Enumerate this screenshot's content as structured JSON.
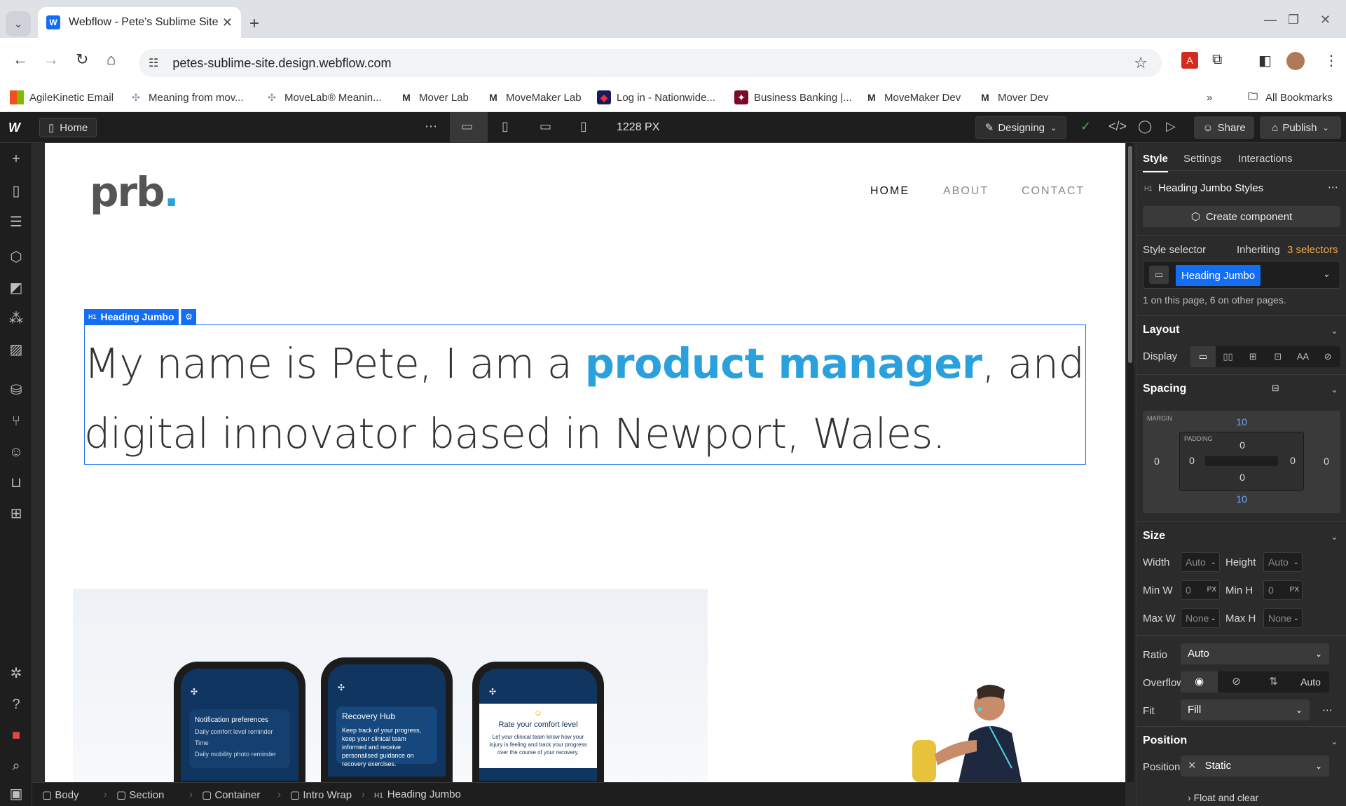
{
  "browser": {
    "tab_title": "Webflow - Pete's Sublime Site",
    "tab_favicon": "W",
    "url": "petes-sublime-site.design.webflow.com",
    "bookmarks": [
      {
        "label": "AgileKinetic Email",
        "icon": "microsoft-icon"
      },
      {
        "label": "Meaning from mov...",
        "icon": "movelab-icon"
      },
      {
        "label": "MoveLab® Meanin...",
        "icon": "movelab-icon"
      },
      {
        "label": "Mover Lab",
        "icon": "M"
      },
      {
        "label": "MoveMaker Lab",
        "icon": "M"
      },
      {
        "label": "Log in - Nationwide...",
        "icon": "nationwide-icon"
      },
      {
        "label": "Business Banking |...",
        "icon": "bank-icon"
      },
      {
        "label": "MoveMaker Dev",
        "icon": "M"
      },
      {
        "label": "Mover Dev",
        "icon": "M"
      }
    ],
    "all_bookmarks_label": "All Bookmarks"
  },
  "designer": {
    "page_label": "Home",
    "width_label": "1228 PX",
    "mode_label": "Designing",
    "share_label": "Share",
    "publish_label": "Publish"
  },
  "site": {
    "logo_text": "prb",
    "logo_dot": ".",
    "nav": [
      "HOME",
      "ABOUT",
      "CONTACT"
    ],
    "heading_before": "My name is Pete, I am a ",
    "heading_highlight": "product manager",
    "heading_after": ", and digital innovator based in Newport, Wales.",
    "highlight_color": "#2aa1dd",
    "phones": [
      {
        "title": "Notification preferences",
        "line1": "Daily comfort level reminder",
        "line2": "Time",
        "line3": "Daily mobility photo reminder"
      },
      {
        "title": "Recovery Hub",
        "text": "Keep track of your progress, keep your clinical team informed and receive personalised guidance on recovery exercises."
      },
      {
        "title": "Rate your comfort level",
        "text": "Let your clinical team know how your injury is feeling and track your progress over the course of your recovery."
      }
    ]
  },
  "selection": {
    "tag": "H1",
    "label": "Heading Jumbo",
    "accent": "#146ef5"
  },
  "breadcrumbs": [
    "Body",
    "Section",
    "Container",
    "Intro Wrap",
    "Heading Jumbo"
  ],
  "breadcrumb_heading_tag": "H1",
  "panel": {
    "tabs": [
      "Style",
      "Settings",
      "Interactions"
    ],
    "element_tag": "H1",
    "element_title": "Heading Jumbo Styles",
    "create_component": "Create component",
    "style_selector_label": "Style selector",
    "inheriting_text": "Inheriting",
    "inheriting_count": "3 selectors",
    "selector_chip": "Heading Jumbo",
    "selector_usage": "1 on this page, 6 on other pages.",
    "layout_title": "Layout",
    "display_label": "Display",
    "display_text_option": "AA",
    "spacing_title": "Spacing",
    "margin_label": "MARGIN",
    "padding_label": "PADDING",
    "margin": {
      "top": "10",
      "right": "0",
      "bottom": "10",
      "left": "0"
    },
    "padding": {
      "top": "0",
      "right": "0",
      "bottom": "0",
      "left": "0"
    },
    "size_title": "Size",
    "size": {
      "width_label": "Width",
      "width": "Auto",
      "height_label": "Height",
      "height": "Auto",
      "minw_label": "Min W",
      "minw": "0",
      "minw_unit": "PX",
      "minh_label": "Min H",
      "minh": "0",
      "minh_unit": "PX",
      "maxw_label": "Max W",
      "maxw": "None",
      "maxh_label": "Max H",
      "maxh": "None",
      "unit_dash": "-"
    },
    "ratio_label": "Ratio",
    "ratio": "Auto",
    "overflow_label": "Overflow",
    "overflow_auto": "Auto",
    "fit_label": "Fit",
    "fit": "Fill",
    "position_title": "Position",
    "position_label": "Position",
    "position": "Static",
    "float_label": "Float and clear"
  }
}
